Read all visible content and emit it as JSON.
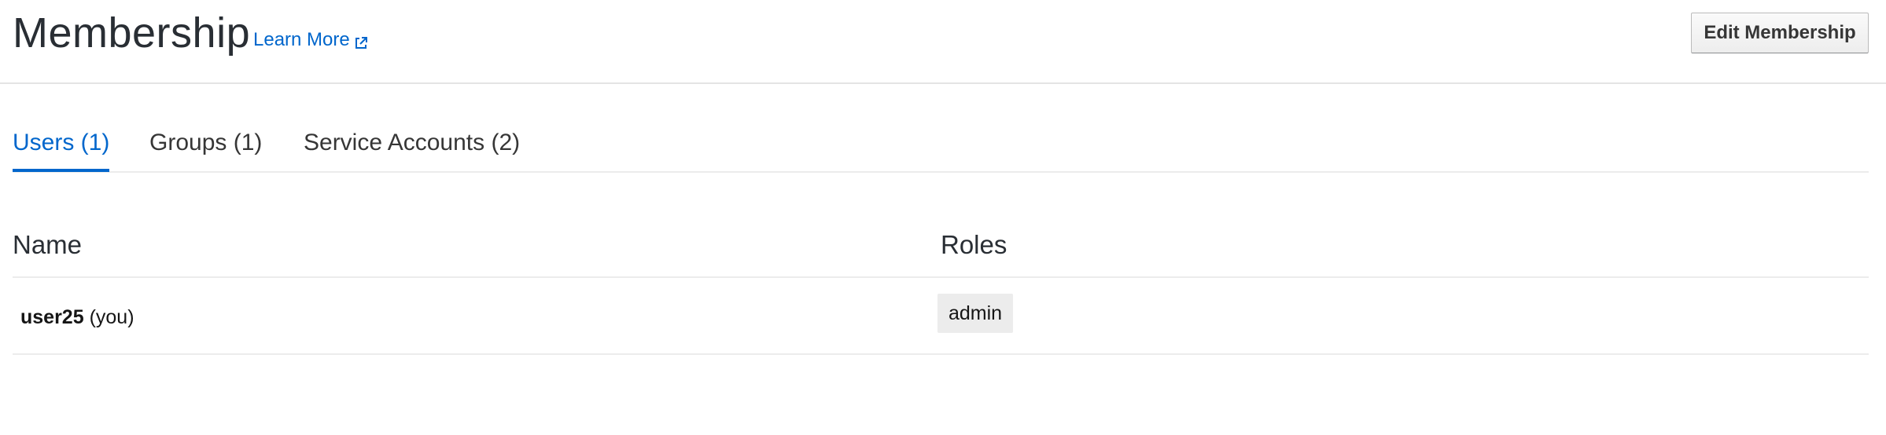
{
  "header": {
    "title": "Membership",
    "learn_more_label": "Learn More",
    "learn_more_icon": "external-link-icon",
    "edit_button_label": "Edit Membership"
  },
  "tabs": [
    {
      "label": "Users (1)",
      "active": true
    },
    {
      "label": "Groups (1)",
      "active": false
    },
    {
      "label": "Service Accounts (2)",
      "active": false
    }
  ],
  "table": {
    "columns": [
      "Name",
      "Roles"
    ],
    "rows": [
      {
        "name": "user25",
        "suffix": "(you)",
        "role": "admin"
      }
    ]
  },
  "colors": {
    "accent": "#0066cc",
    "divider": "#ececec",
    "badge_bg": "#ececec"
  }
}
